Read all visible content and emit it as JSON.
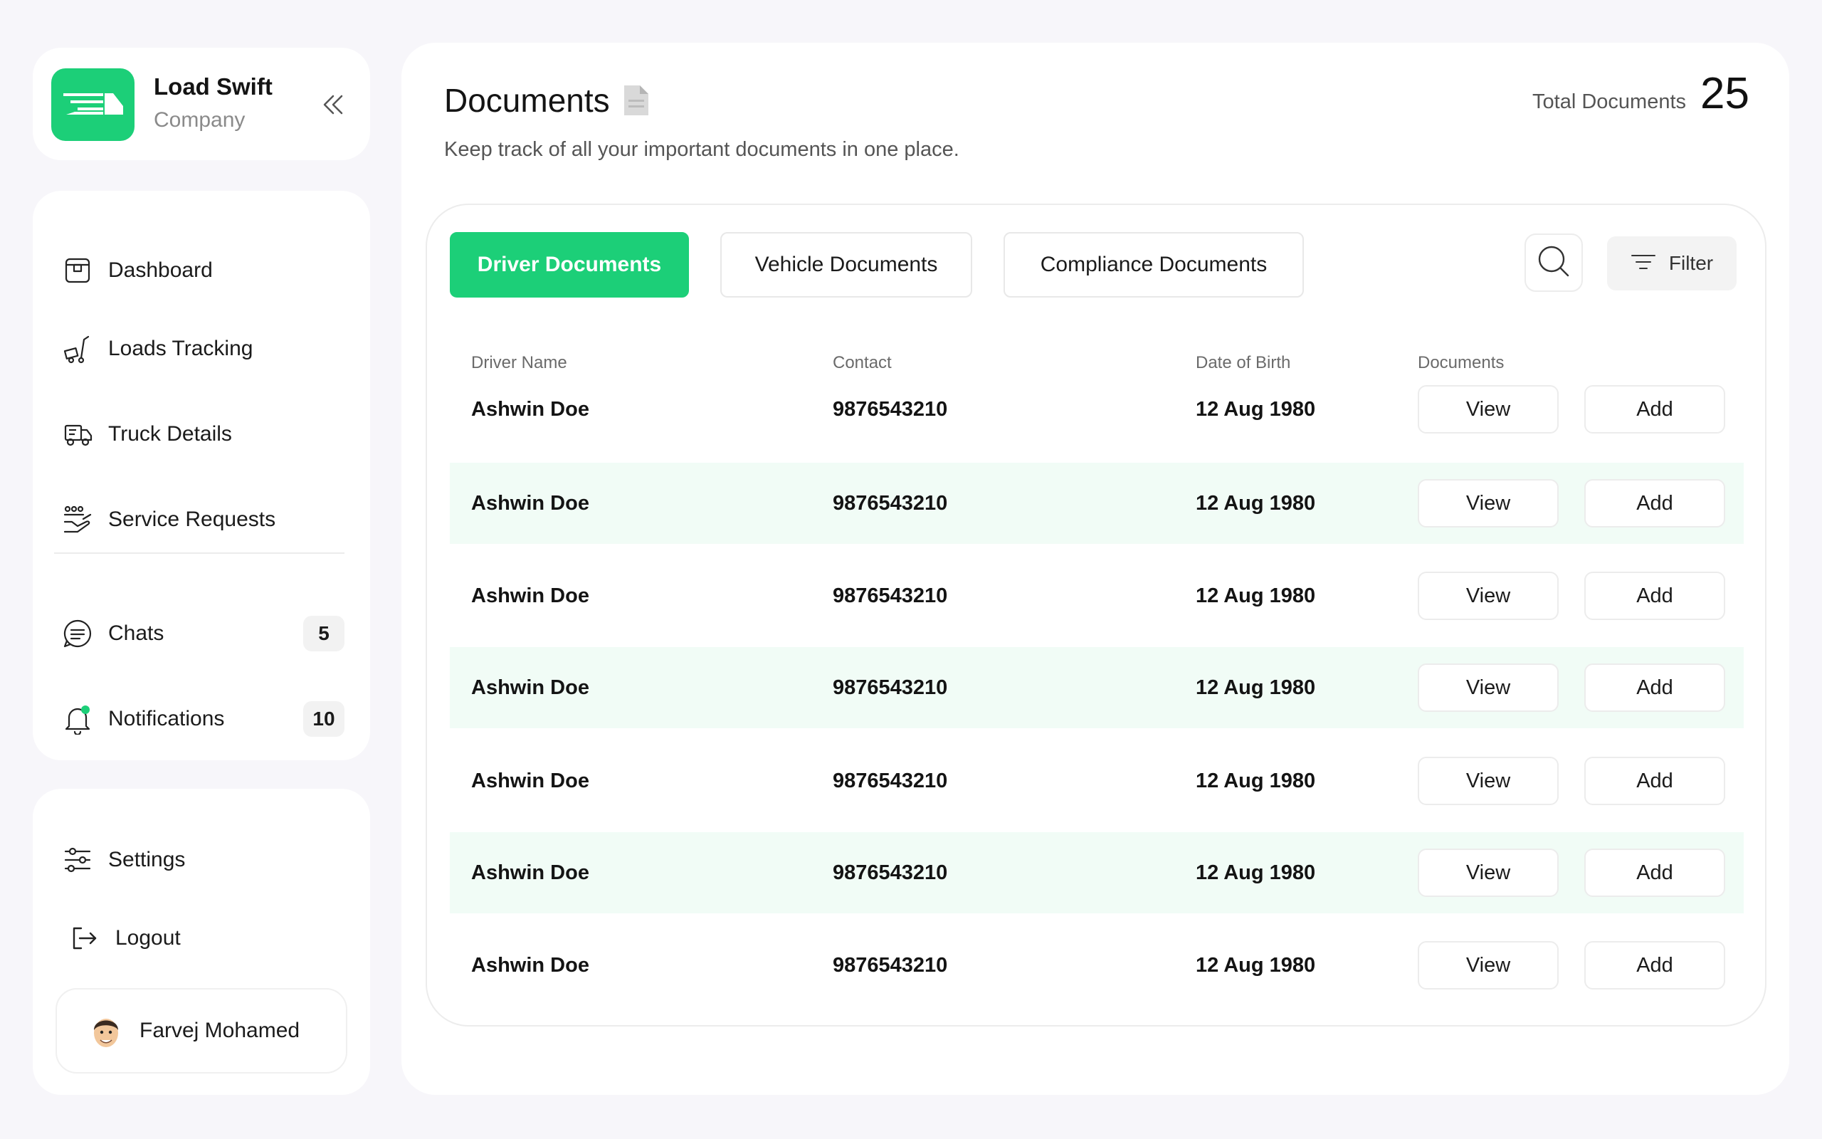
{
  "brand": {
    "name": "Load Swift",
    "subtitle": "Company"
  },
  "nav": {
    "items": [
      {
        "label": "Dashboard",
        "icon": "dashboard-icon"
      },
      {
        "label": "Loads Tracking",
        "icon": "loads-tracking-icon"
      },
      {
        "label": "Truck Details",
        "icon": "truck-icon"
      },
      {
        "label": "Service Requests",
        "icon": "service-requests-icon"
      }
    ],
    "chats": {
      "label": "Chats",
      "count": "5",
      "icon": "chat-icon"
    },
    "notifications": {
      "label": "Notifications",
      "count": "10",
      "icon": "bell-icon"
    }
  },
  "bottom": {
    "settings_label": "Settings",
    "logout_label": "Logout",
    "user_name": "Farvej Mohamed"
  },
  "header": {
    "title": "Documents",
    "description": "Keep track of all your important documents in one place.",
    "total_label": "Total Documents",
    "total_value": "25"
  },
  "tabs": [
    "Driver Documents",
    "Vehicle Documents",
    "Compliance Documents"
  ],
  "active_tab": "Driver Documents",
  "filter_label": "Filter",
  "table": {
    "columns": [
      "Driver Name",
      "Contact",
      "Date of Birth",
      "Documents"
    ],
    "view_label": "View",
    "add_label": "Add",
    "rows": [
      {
        "name": "Ashwin Doe",
        "contact": "9876543210",
        "dob": "12 Aug 1980"
      },
      {
        "name": "Ashwin Doe",
        "contact": "9876543210",
        "dob": "12 Aug 1980"
      },
      {
        "name": "Ashwin Doe",
        "contact": "9876543210",
        "dob": "12 Aug 1980"
      },
      {
        "name": "Ashwin Doe",
        "contact": "9876543210",
        "dob": "12 Aug 1980"
      },
      {
        "name": "Ashwin Doe",
        "contact": "9876543210",
        "dob": "12 Aug 1980"
      },
      {
        "name": "Ashwin Doe",
        "contact": "9876543210",
        "dob": "12 Aug 1980"
      },
      {
        "name": "Ashwin Doe",
        "contact": "9876543210",
        "dob": "12 Aug 1980"
      }
    ]
  },
  "colors": {
    "accent": "#1ccf78",
    "row_alt": "#f1fcf6",
    "background": "#f7f6fa"
  }
}
